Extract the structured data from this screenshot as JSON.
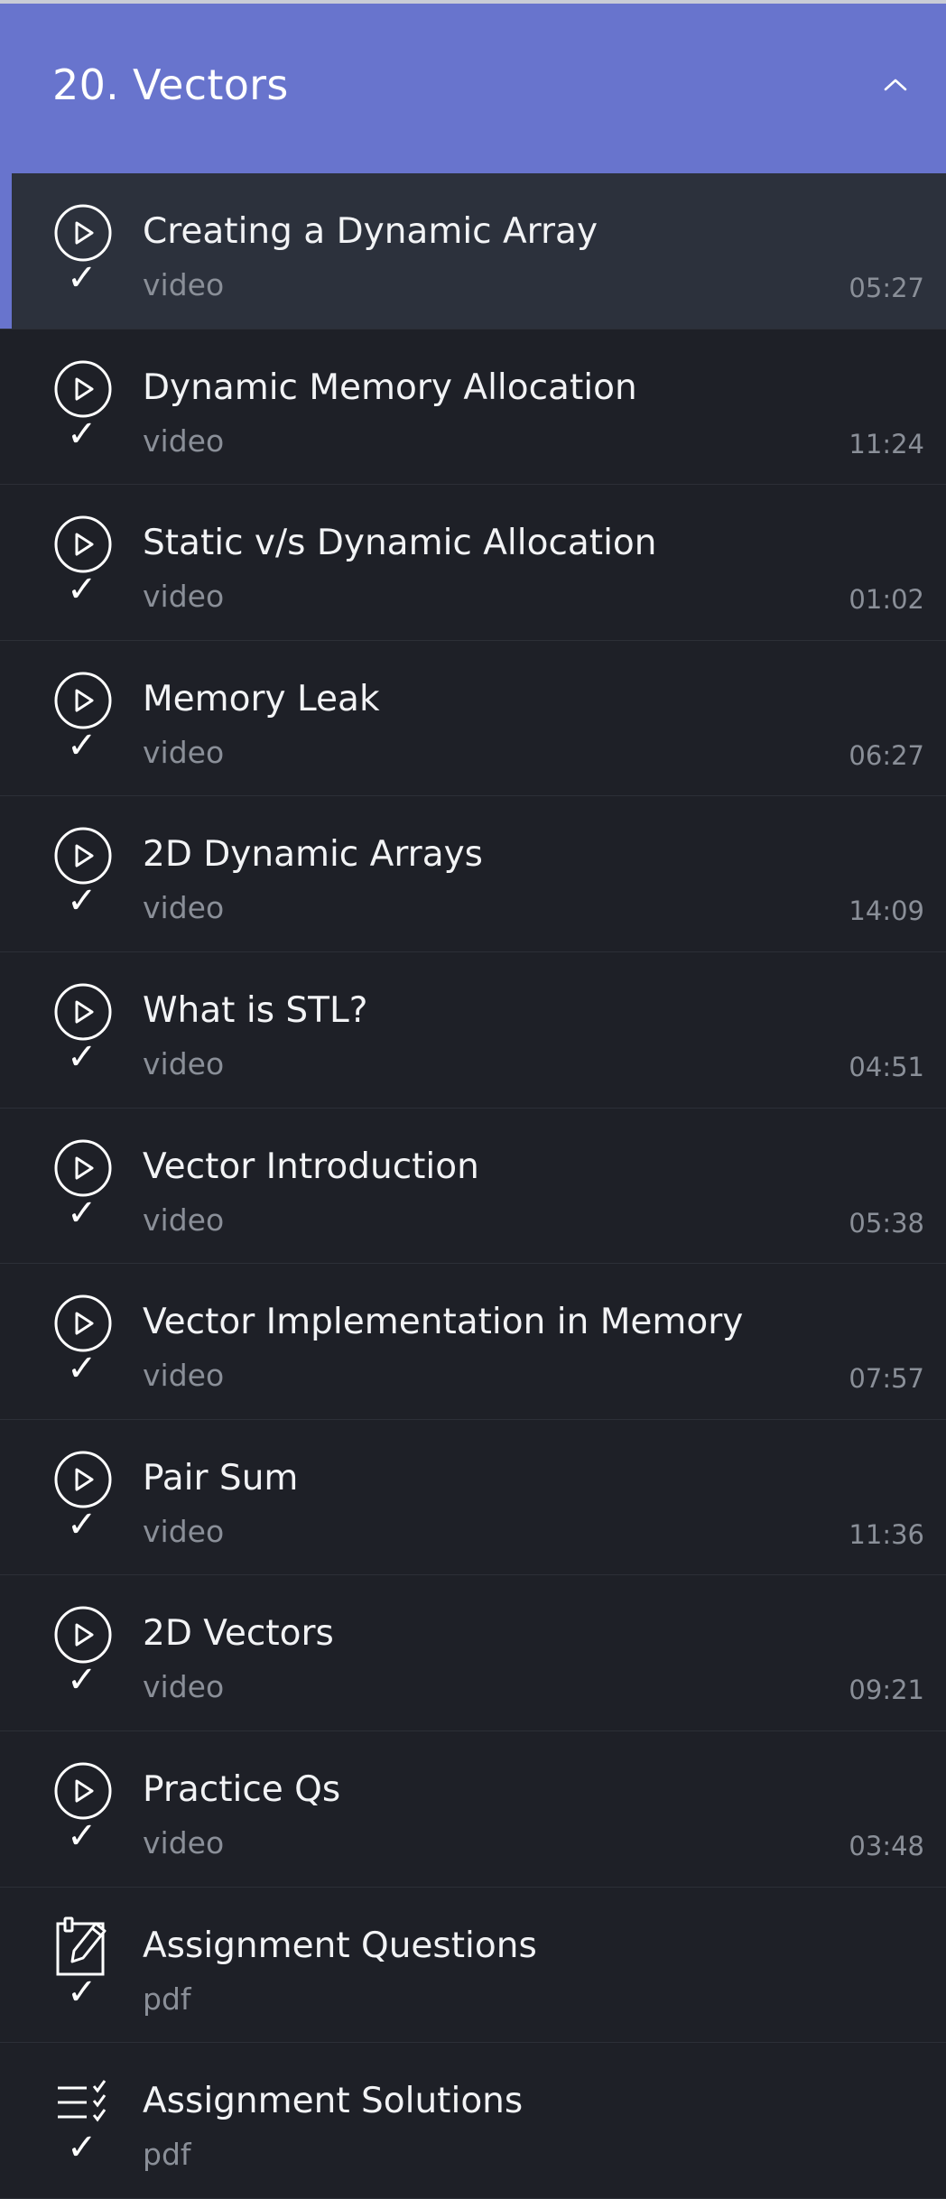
{
  "section": {
    "title": "20. Vectors",
    "collapse_icon": "chevron-up-icon"
  },
  "colors": {
    "accent": "#6874cd",
    "background": "#1e2027",
    "active_row": "#2c313c",
    "muted_text": "#8a8f98"
  },
  "lessons": [
    {
      "title": "Creating a Dynamic Array",
      "type": "video",
      "duration": "05:27",
      "icon": "play-circle-icon",
      "completed": true,
      "active": true
    },
    {
      "title": "Dynamic Memory Allocation",
      "type": "video",
      "duration": "11:24",
      "icon": "play-circle-icon",
      "completed": true,
      "active": false
    },
    {
      "title": "Static v/s Dynamic Allocation",
      "type": "video",
      "duration": "01:02",
      "icon": "play-circle-icon",
      "completed": true,
      "active": false
    },
    {
      "title": "Memory Leak",
      "type": "video",
      "duration": "06:27",
      "icon": "play-circle-icon",
      "completed": true,
      "active": false
    },
    {
      "title": "2D Dynamic Arrays",
      "type": "video",
      "duration": "14:09",
      "icon": "play-circle-icon",
      "completed": true,
      "active": false
    },
    {
      "title": "What is STL?",
      "type": "video",
      "duration": "04:51",
      "icon": "play-circle-icon",
      "completed": true,
      "active": false
    },
    {
      "title": "Vector Introduction",
      "type": "video",
      "duration": "05:38",
      "icon": "play-circle-icon",
      "completed": true,
      "active": false
    },
    {
      "title": "Vector Implementation in Memory",
      "type": "video",
      "duration": "07:57",
      "icon": "play-circle-icon",
      "completed": true,
      "active": false
    },
    {
      "title": "Pair Sum",
      "type": "video",
      "duration": "11:36",
      "icon": "play-circle-icon",
      "completed": true,
      "active": false
    },
    {
      "title": "2D Vectors",
      "type": "video",
      "duration": "09:21",
      "icon": "play-circle-icon",
      "completed": true,
      "active": false
    },
    {
      "title": "Practice Qs",
      "type": "video",
      "duration": "03:48",
      "icon": "play-circle-icon",
      "completed": true,
      "active": false
    },
    {
      "title": "Assignment Questions",
      "type": "pdf",
      "duration": "",
      "icon": "clipboard-edit-icon",
      "completed": true,
      "active": false
    },
    {
      "title": "Assignment Solutions",
      "type": "pdf",
      "duration": "",
      "icon": "checklist-icon",
      "completed": true,
      "active": false
    }
  ],
  "check_glyph": "✓"
}
